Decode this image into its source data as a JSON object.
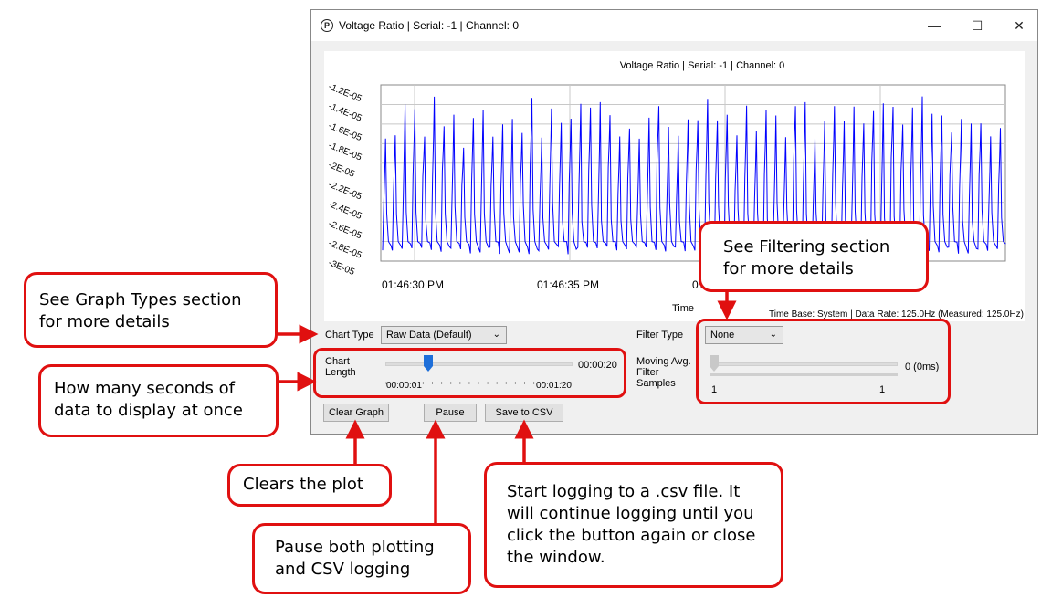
{
  "window": {
    "title": "Voltage Ratio | Serial: -1 | Channel: 0",
    "controls": {
      "minimize": "—",
      "maximize": "☐",
      "close": "✕"
    }
  },
  "chart_data": {
    "type": "line",
    "title": "Voltage Ratio | Serial: -1 | Channel: 0",
    "xlabel": "Time",
    "ylabel": "",
    "y_tick_labels": [
      "-1.2E-05",
      "-1.4E-05",
      "-1.6E-05",
      "-1.8E-05",
      "-2E-05",
      "-2.2E-05",
      "-2.4E-05",
      "-2.6E-05",
      "-2.8E-05",
      "-3E-05"
    ],
    "ylim": [
      -3e-05,
      -1.2e-05
    ],
    "x_tick_labels": [
      "01:46:30 PM",
      "01:46:35 PM",
      "01:46:40 PM"
    ],
    "series": [
      {
        "color": "#0000ff",
        "pattern": "periodic spikes from about -2.9E-05 up to about -1.5E-05, roughly 64 cycles"
      }
    ],
    "grid": true,
    "footer": "Time Base: System  |  Data Rate: 125.0Hz (Measured: 125.0Hz)"
  },
  "controls": {
    "chart_type_label": "Chart Type",
    "chart_type_value": "Raw Data (Default)",
    "chart_length_label": "Chart Length",
    "chart_length_value": "00:00:20",
    "chart_length_min": "00:00:01",
    "chart_length_max": "00:01:20",
    "chart_length_position": 0.23,
    "filter_type_label": "Filter Type",
    "filter_type_value": "None",
    "moving_avg_label": "Moving Avg. Filter Samples",
    "moving_avg_value": "0 (0ms)",
    "moving_avg_min": "1",
    "moving_avg_max": "1",
    "clear_label": "Clear Graph",
    "pause_label": "Pause",
    "save_label": "Save to CSV"
  },
  "callouts": {
    "graph_types": "See Graph Types section for more details",
    "chart_length": "How many seconds of data to display at once",
    "filtering": "See Filtering section for more details",
    "clear": "Clears the plot",
    "pause": "Pause both plotting and CSV logging",
    "save": "Start logging to a .csv file. It will continue logging until you click the button again or close the window."
  },
  "colors": {
    "callout_border": "#e01010",
    "series": "#0000ff",
    "slider_thumb": "#1e6fd9"
  }
}
